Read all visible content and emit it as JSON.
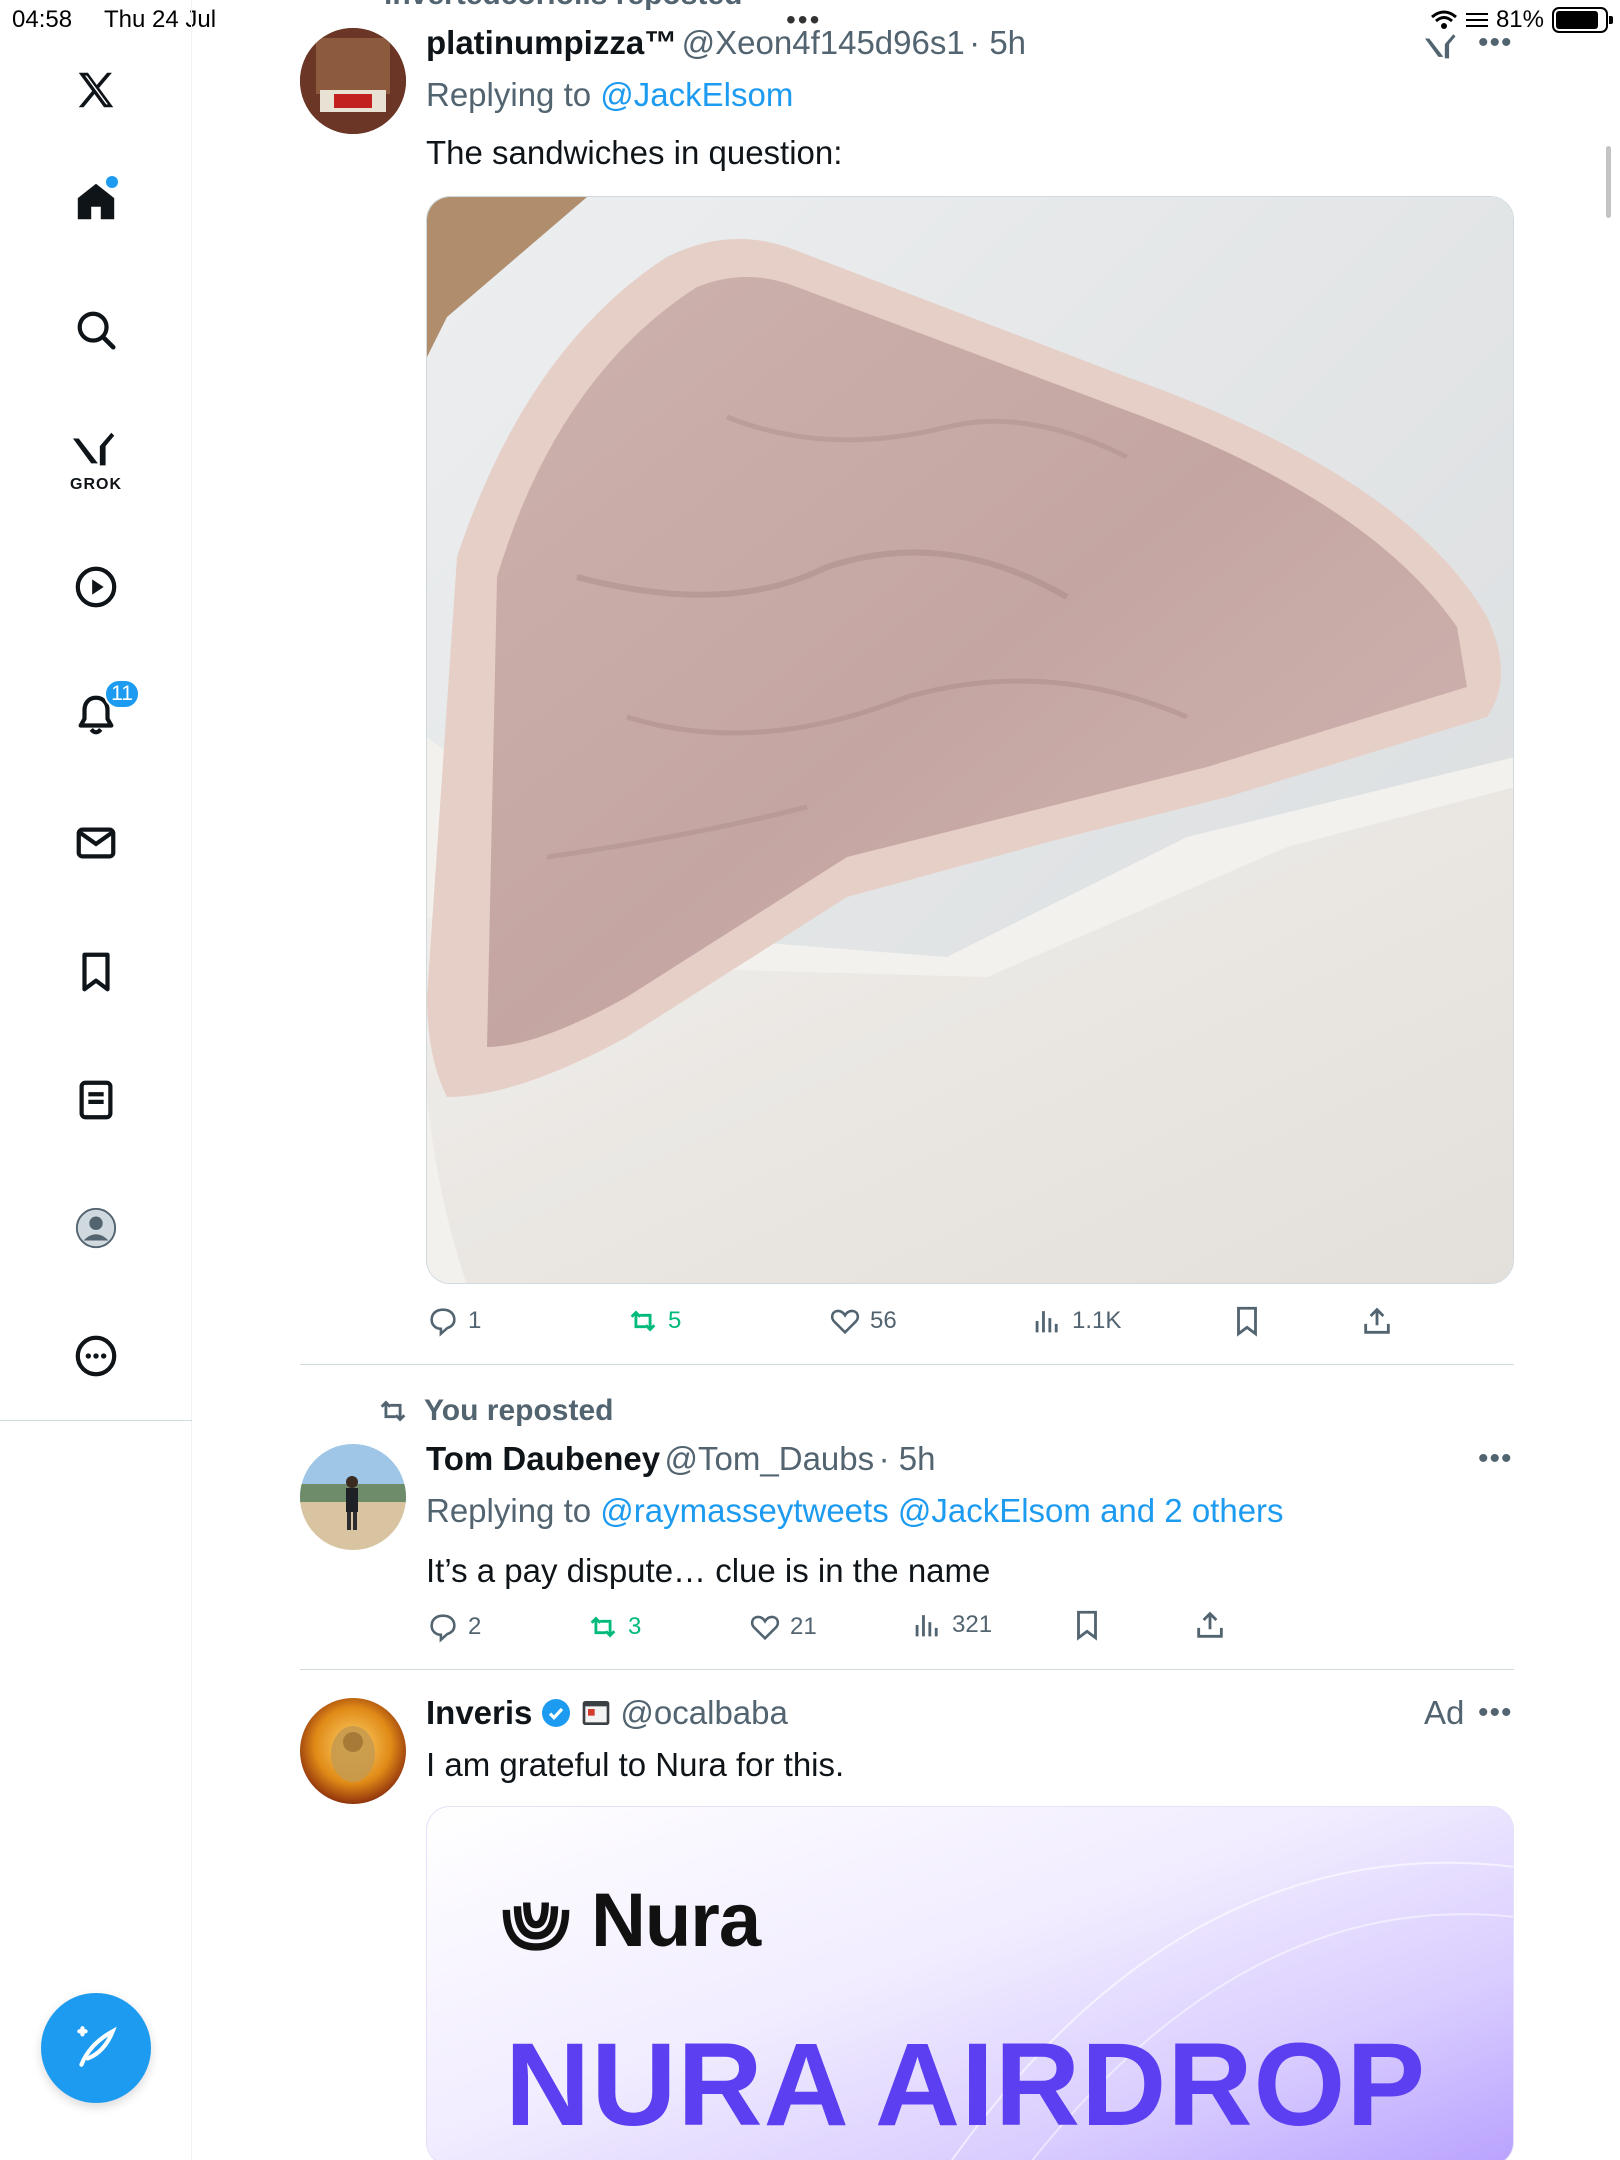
{
  "status": {
    "time": "04:58",
    "date": "Thu 24 Jul",
    "battery": "81%",
    "battery_level": 0.81
  },
  "sidebar": {
    "notifications_badge": "11",
    "grok_label": "GROK"
  },
  "tweets": [
    {
      "repost_label": "invertedcoriolis reposted",
      "name": "platinumpizza™",
      "handle": "@Xeon4f145d96s1",
      "time": "· 5h",
      "reply_prefix": "Replying to",
      "reply_to": "@JackElsom",
      "text": "The sandwiches in question:",
      "actions": {
        "replies": "1",
        "reposts": "5",
        "likes": "56",
        "views": "1.1K"
      }
    },
    {
      "repost_label": "You reposted",
      "name": "Tom Daubeney",
      "handle": "@Tom_Daubs",
      "time": "· 5h",
      "reply_prefix": "Replying to",
      "reply_to": "@raymasseytweets @JackElsom and 2 others",
      "text": "It’s a pay dispute… clue is in the name",
      "actions": {
        "replies": "2",
        "reposts": "3",
        "likes": "21",
        "views": "321"
      }
    },
    {
      "name": "Inveris",
      "handle": "@ocalbaba",
      "ad_label": "Ad",
      "text": "I am grateful to Nura for this.",
      "card": {
        "brand": "Nura",
        "headline": "NURA AIRDROP"
      }
    }
  ],
  "colors": {
    "accent": "#1d9bf0",
    "repost_green": "#00ba7c",
    "secondary_text": "#536471",
    "ad_purple": "#5b3ff0"
  },
  "icons": [
    "x-logo-icon",
    "home-icon",
    "search-icon",
    "grok-icon",
    "video-icon",
    "bell-icon",
    "mail-icon",
    "bookmark-icon",
    "list-icon",
    "profile-icon",
    "more-icon",
    "compose-icon"
  ]
}
